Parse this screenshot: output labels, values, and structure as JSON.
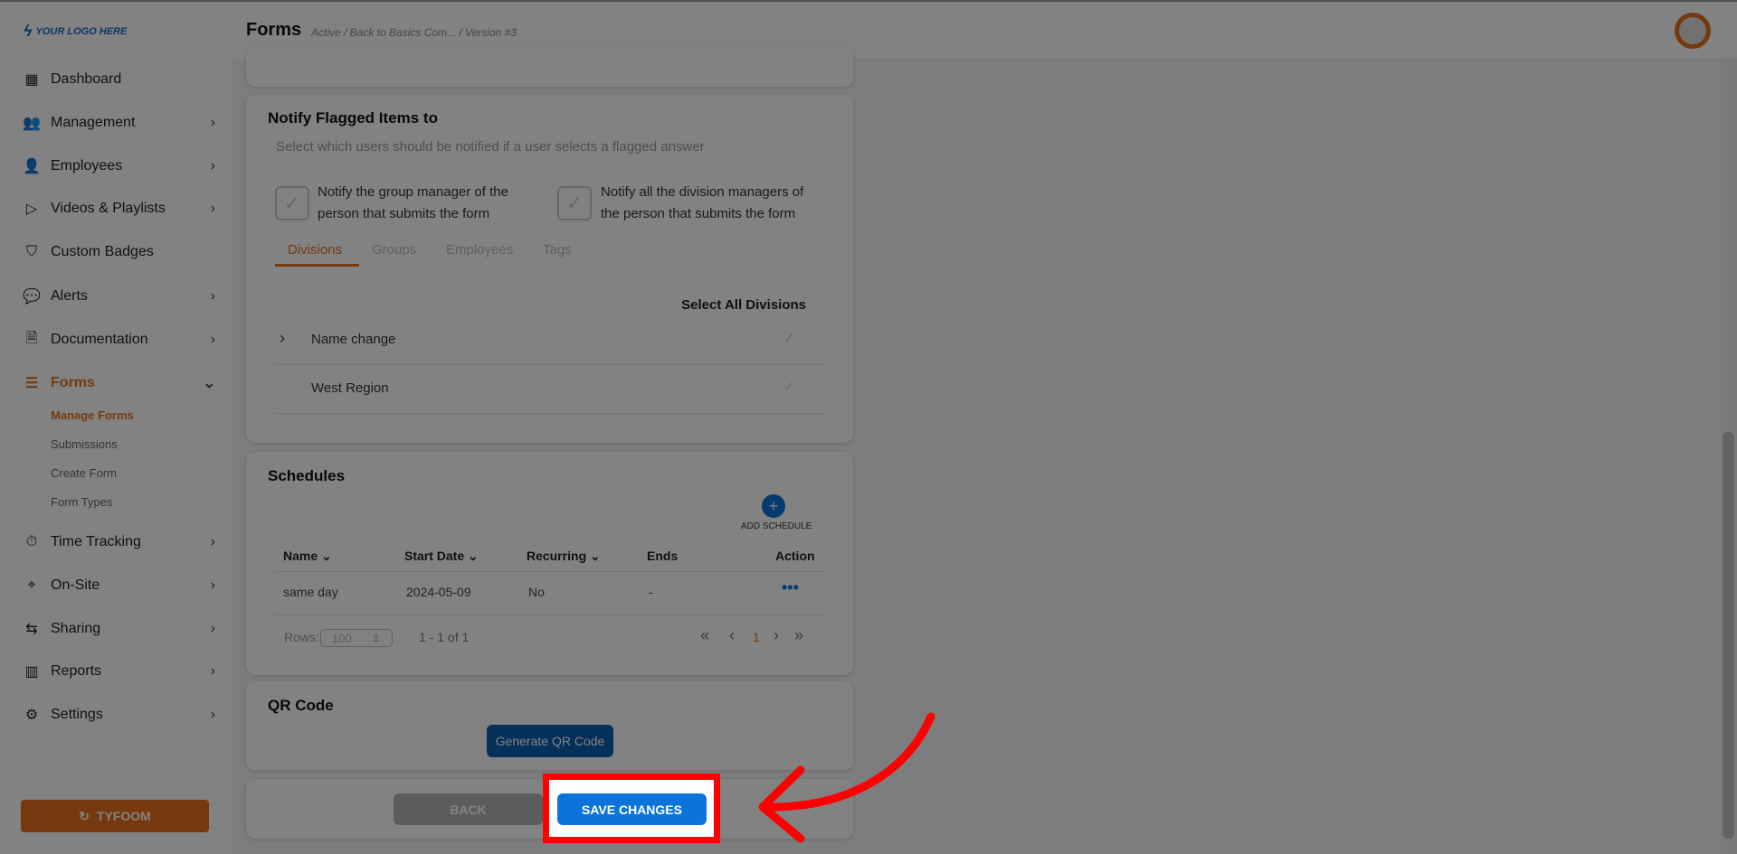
{
  "header": {
    "logo": "YOUR LOGO HERE",
    "title": "Forms",
    "breadcrumb": "Active / Back to Basics Com... / Version #3"
  },
  "sidebar": {
    "items": [
      {
        "label": "Dashboard",
        "icon": "dashboard-icon"
      },
      {
        "label": "Management",
        "icon": "people-icon"
      },
      {
        "label": "Employees",
        "icon": "person-icon"
      },
      {
        "label": "Videos & Playlists",
        "icon": "video-icon"
      },
      {
        "label": "Custom Badges",
        "icon": "badge-icon"
      },
      {
        "label": "Alerts",
        "icon": "chat-icon"
      },
      {
        "label": "Documentation",
        "icon": "document-icon"
      },
      {
        "label": "Forms",
        "icon": "list-icon"
      },
      {
        "label": "Time Tracking",
        "icon": "stopwatch-icon"
      },
      {
        "label": "On-Site",
        "icon": "location-icon"
      },
      {
        "label": "Sharing",
        "icon": "share-icon"
      },
      {
        "label": "Reports",
        "icon": "bar-chart-icon"
      },
      {
        "label": "Settings",
        "icon": "gear-icon"
      }
    ],
    "forms_sub": [
      "Manage Forms",
      "Submissions",
      "Create Form",
      "Form Types"
    ],
    "footer_button": "TYFOOM"
  },
  "notify": {
    "title": "Notify Flagged Items to",
    "subtitle": "Select which users should be notified if a user selects a flagged answer",
    "option1": [
      "Notify the group manager of the",
      "person that submits the form"
    ],
    "option2": [
      "Notify all the division managers of",
      "the person that submits the form"
    ],
    "tabs": [
      "Divisions",
      "Groups",
      "Employees",
      "Tags"
    ],
    "active_tab": "Divisions",
    "select_all": "Select All Divisions",
    "divisions": [
      "Name change",
      "West Region"
    ]
  },
  "schedules": {
    "title": "Schedules",
    "add_label": "ADD SCHEDULE",
    "columns": [
      "Name",
      "Start Date",
      "Recurring",
      "Ends",
      "Action"
    ],
    "rows": [
      {
        "name": "same day",
        "start": "2024-05-09",
        "recurring": "No",
        "ends": "-"
      }
    ],
    "rows_label": "Rows:",
    "rows_value": "100",
    "range": "1 - 1 of 1",
    "page": "1"
  },
  "qr": {
    "title": "QR Code",
    "button": "Generate QR Code"
  },
  "actions": {
    "back": "BACK",
    "save": "SAVE CHANGES"
  },
  "colors": {
    "accent": "#e8711c",
    "primary": "#0a74da",
    "highlight": "#ff0000"
  }
}
